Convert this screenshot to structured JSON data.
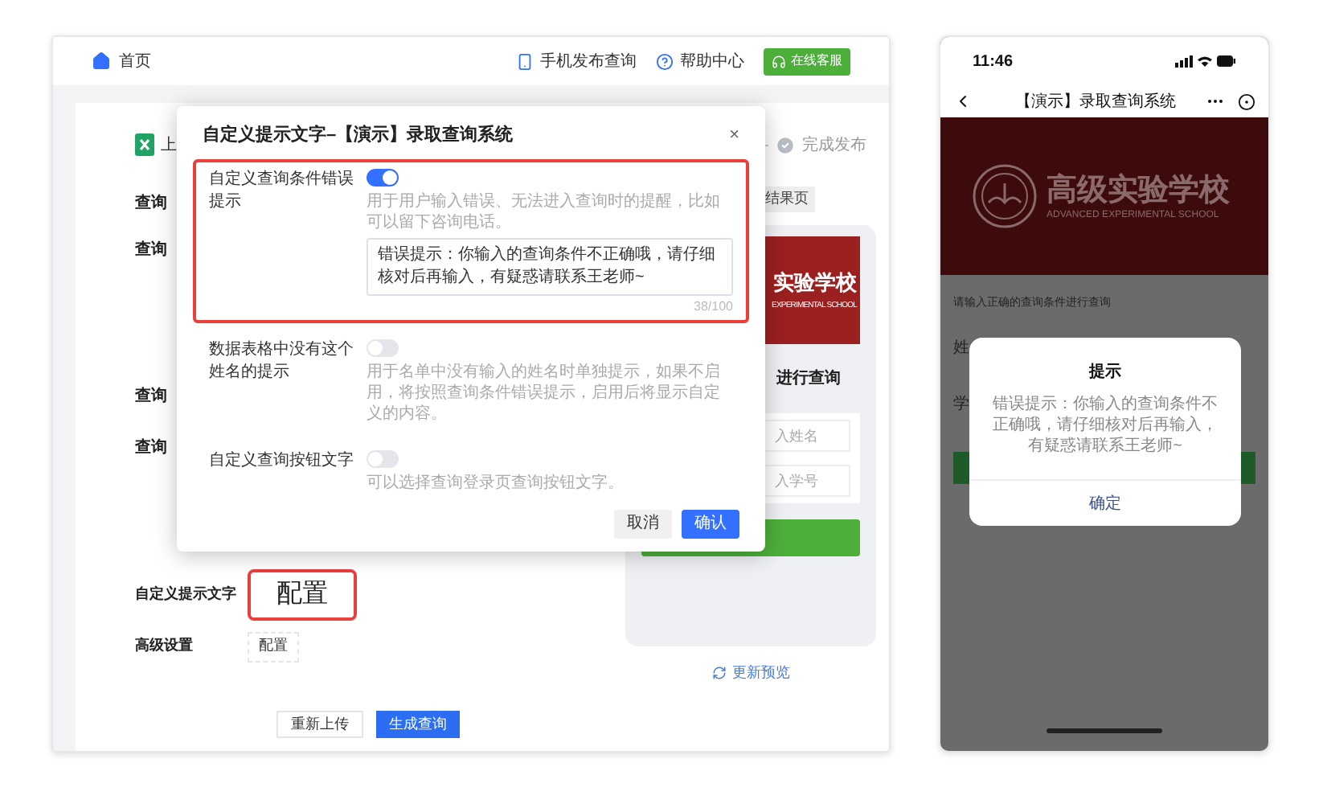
{
  "top_bar": {
    "home": "首页",
    "links": [
      {
        "kind": "phone",
        "label": "手机发布查询"
      },
      {
        "kind": "help",
        "label": "帮助中心"
      }
    ],
    "service_button": "在线客服"
  },
  "steps": [
    {
      "kind": "excel",
      "label": "上"
    },
    {
      "kind": "check",
      "label": "完成发布"
    }
  ],
  "form": {
    "rows": [
      {
        "label": "查询"
      },
      {
        "label": "查询"
      },
      {
        "label": "查询"
      },
      {
        "label": "查询"
      }
    ],
    "config_rows": [
      {
        "label": "自定义提示文字",
        "button": "配置",
        "highlighted": true
      },
      {
        "label": "高级设置",
        "button": "配置",
        "highlighted": false
      }
    ],
    "actions": [
      {
        "kind": "secondary",
        "label": "重新上传"
      },
      {
        "kind": "primary",
        "label": "生成查询"
      }
    ]
  },
  "preview": {
    "result_tab": "结果页",
    "banner_title": "实验学校",
    "banner_subtitle": "EXPERIMENTAL SCHOOL",
    "heading": "进行查询",
    "inputs": [
      {
        "placeholder": "入姓名"
      },
      {
        "placeholder": "入学号"
      }
    ],
    "refresh": "更新预览"
  },
  "modal": {
    "title": "自定义提示文字–【演示】录取查询系统",
    "close": "×",
    "settings": [
      {
        "label": "自定义查询条件错误提示",
        "on": true,
        "highlighted": true,
        "description": "用于用户输入错误、无法进入查询时的提醒，比如可以留下咨询电话。",
        "value": "错误提示：你输入的查询条件不正确哦，请仔细核对后再输入，有疑惑请联系王老师~",
        "counter": "38/100"
      },
      {
        "label": "数据表格中没有这个姓名的提示",
        "on": false,
        "highlighted": false,
        "description": "用于名单中没有输入的姓名时单独提示，如果不启用，将按照查询条件错误提示，启用后将显示自定义的内容。"
      },
      {
        "label": "自定义查询按钮文字",
        "on": false,
        "highlighted": false,
        "description": "可以选择查询登录页查询按钮文字。"
      }
    ],
    "buttons": [
      {
        "kind": "secondary",
        "label": "取消"
      },
      {
        "kind": "primary",
        "label": "确认"
      }
    ]
  },
  "phone": {
    "time": "11:46",
    "title": "【演示】录取查询系统",
    "school_name": "高级实验学校",
    "school_name_en": "ADVANCED EXPERIMENTAL SCHOOL",
    "hint": "请输入正确的查询条件进行查询",
    "field_labels": [
      "姓",
      "学"
    ],
    "dialog": {
      "title": "提示",
      "message": "错误提示：你输入的查询条件不正确哦，请仔细核对后再输入，有疑惑请联系王老师~",
      "button": "确定"
    }
  }
}
